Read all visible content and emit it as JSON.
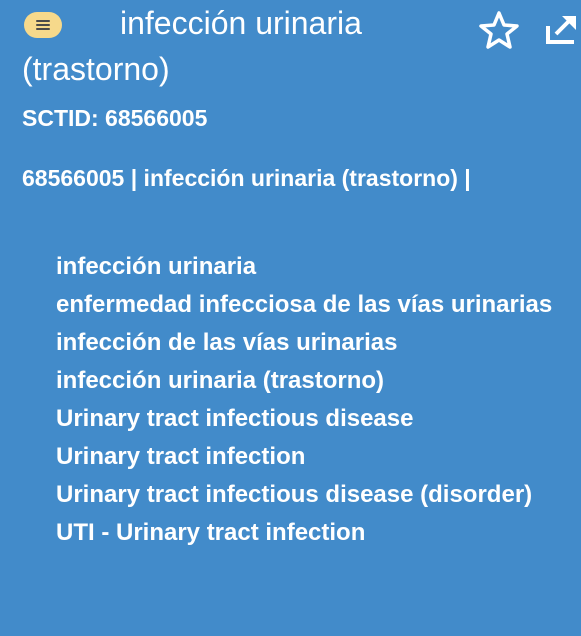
{
  "header": {
    "title": "infección urinaria (trastorno)",
    "menu_icon": "menu-icon",
    "star_icon": "star-outline-icon",
    "export_icon": "export-icon"
  },
  "concept": {
    "sctid_line": "SCTID: 68566005",
    "fsn_line": "68566005 | infección urinaria (trastorno) |"
  },
  "descriptions": [
    "infección urinaria",
    "enfermedad infecciosa de las vías urinarias",
    "infección de las vías urinarias",
    "infección urinaria (trastorno)",
    "Urinary tract infectious disease",
    "Urinary tract infection",
    "Urinary tract infectious disease (disorder)",
    "UTI - Urinary tract infection"
  ],
  "colors": {
    "panel_background": "#428bca",
    "menu_pill": "#f6d98b",
    "text": "#ffffff"
  }
}
